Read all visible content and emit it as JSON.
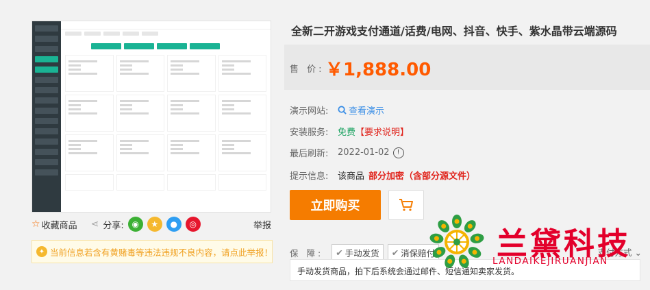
{
  "product": {
    "title": "全新二开游戏支付通道/话费/电网、抖音、快手、紫水晶带云端源码",
    "price_label": "售 价:",
    "price": "￥1,888.00"
  },
  "info": {
    "demo_label": "演示网站:",
    "demo_link": "查看演示",
    "install_label": "安装服务:",
    "install_free": "免费",
    "install_req": "【要求说明】",
    "refresh_label": "最后刷新:",
    "refresh_date": "2022-01-02",
    "tip_label": "提示信息:",
    "tip_prefix": "该商品",
    "tip_red": "部分加密（含部分源文件）"
  },
  "buttons": {
    "buy": "立即购买",
    "cart_icon": "cart-icon"
  },
  "guarantee": {
    "label": "保 障:",
    "tags": [
      "手动发货",
      "消保赔付"
    ],
    "pay_method": "支付方式",
    "delivery_note": "手动发货商品，拍下后系统会通过邮件、短信通知卖家发货。"
  },
  "actions": {
    "favorite": "收藏商品",
    "share": "分享:",
    "report": "举报"
  },
  "notice": "当前信息若含有黄赌毒等违法违规不良内容，请点此举报！",
  "watermark": {
    "cn": "兰黛科技",
    "en": "LANDAIKEJIRUANJIAN"
  },
  "colors": {
    "price": "#ff5a00",
    "buy_button": "#f57c00",
    "watermark": "#e3002b",
    "link": "#3a8ee6"
  }
}
